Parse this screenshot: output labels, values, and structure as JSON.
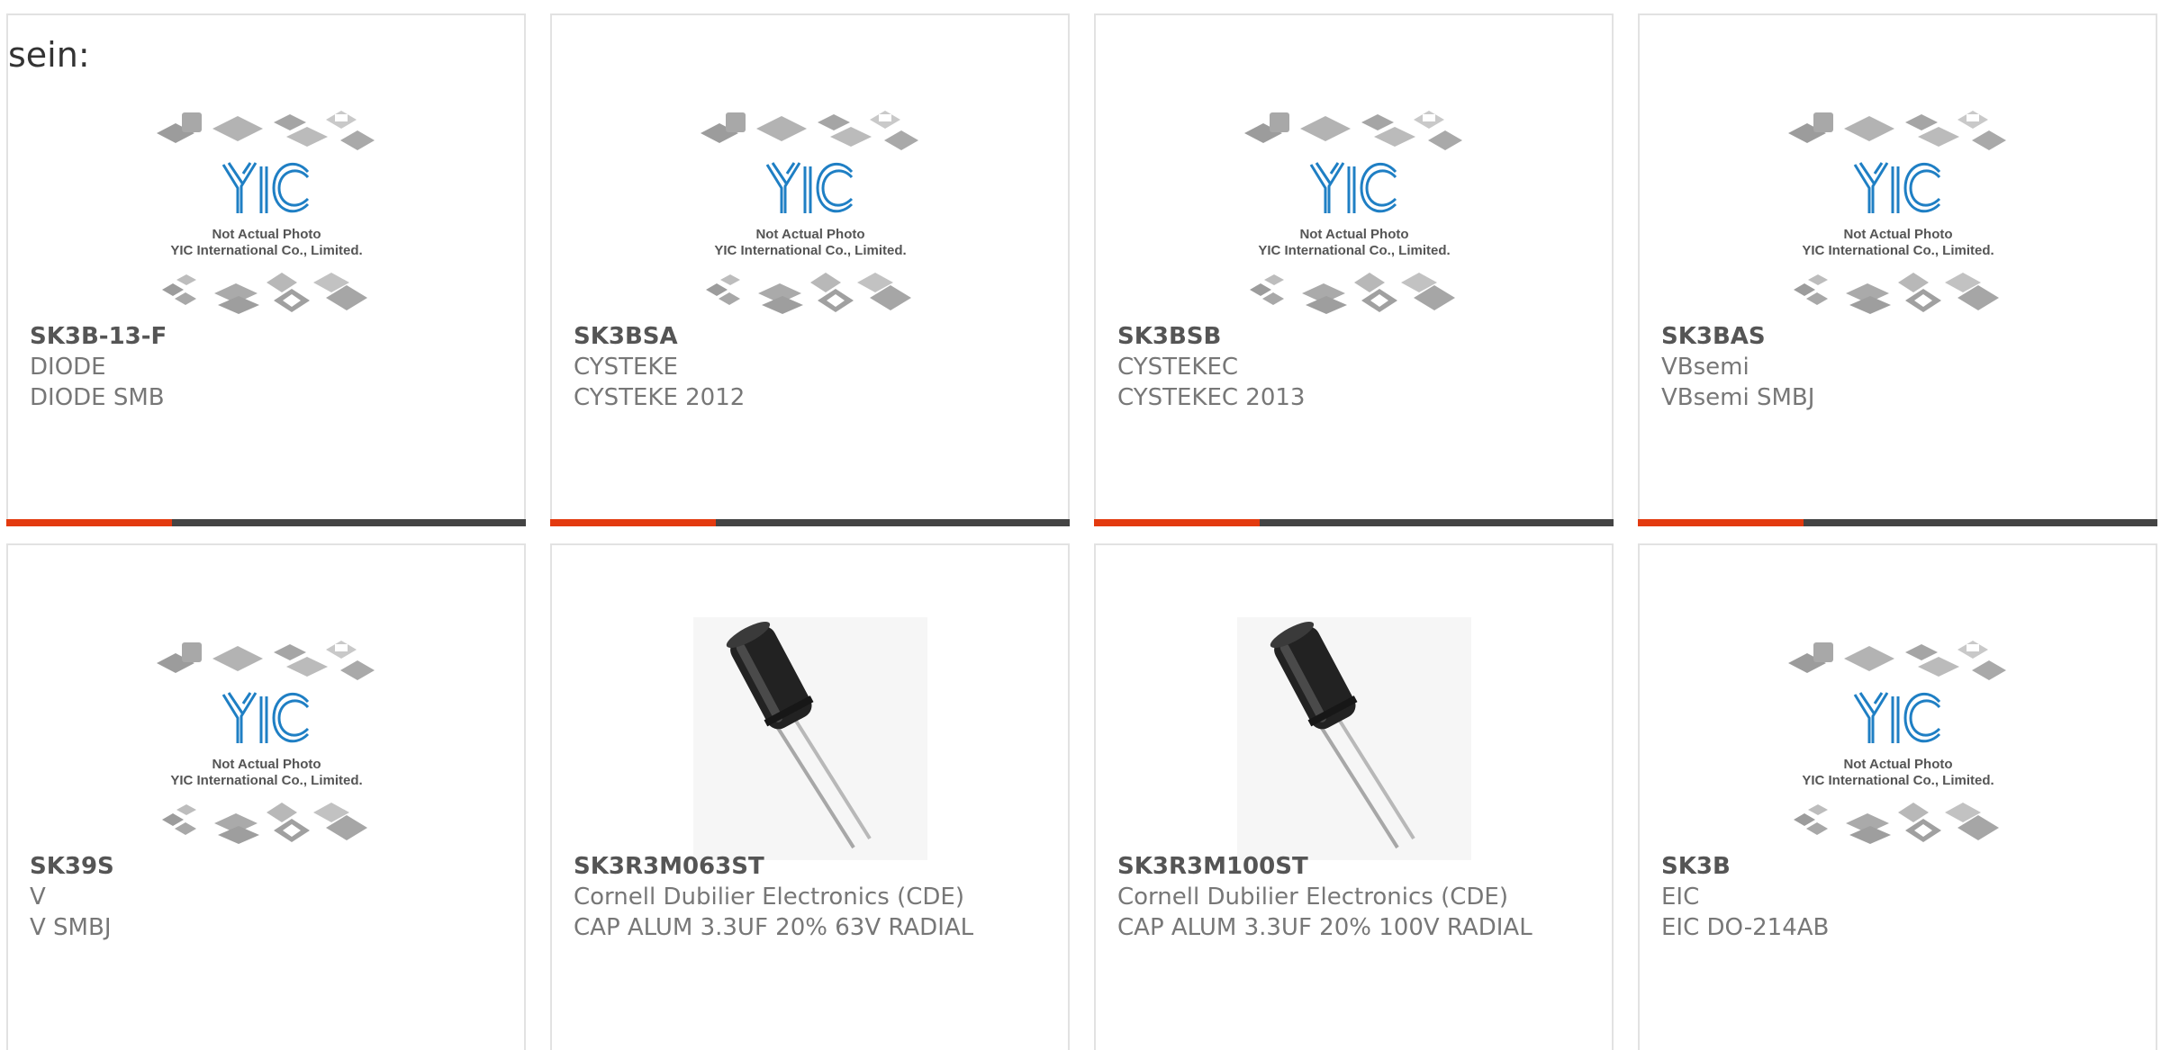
{
  "header": {
    "lead_text": "sein:"
  },
  "placeholder": {
    "caption_line1": "Not Actual Photo",
    "caption_line2": "YIC International Co., Limited.",
    "logo_text": "YIC"
  },
  "colors": {
    "accent": "#e33a0f",
    "bar_dark": "#444444",
    "logo_blue": "#1f7fc4",
    "text": "#777777"
  },
  "products": [
    {
      "part": "SK3B-13-F",
      "maker": "DIODE",
      "desc": "DIODE SMB",
      "image": "placeholder-photo"
    },
    {
      "part": "SK3BSA",
      "maker": "CYSTEKE",
      "desc": "CYSTEKE 2012",
      "image": "placeholder-photo"
    },
    {
      "part": "SK3BSB",
      "maker": "CYSTEKEC",
      "desc": "CYSTEKEC 2013",
      "image": "placeholder-photo"
    },
    {
      "part": "SK3BAS",
      "maker": "VBsemi",
      "desc": "VBsemi SMBJ",
      "image": "placeholder-photo"
    },
    {
      "part": "SK39S",
      "maker": "V",
      "desc": "V SMBJ",
      "image": "placeholder-photo"
    },
    {
      "part": "SK3R3M063ST",
      "maker": "Cornell Dubilier Electronics (CDE)",
      "desc": "CAP ALUM 3.3UF 20% 63V RADIAL",
      "image": "capacitor-photo"
    },
    {
      "part": "SK3R3M100ST",
      "maker": "Cornell Dubilier Electronics (CDE)",
      "desc": "CAP ALUM 3.3UF 20% 100V RADIAL",
      "image": "capacitor-photo"
    },
    {
      "part": "SK3B",
      "maker": "EIC",
      "desc": "EIC DO-214AB",
      "image": "placeholder-photo"
    }
  ]
}
